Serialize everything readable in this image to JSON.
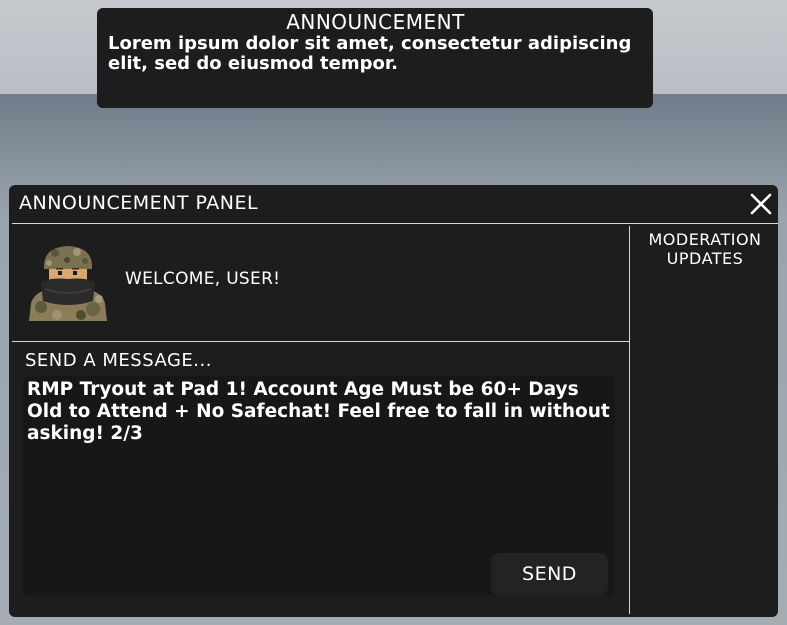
{
  "announcement": {
    "title": "ANNOUNCEMENT",
    "body": "Lorem ipsum dolor sit amet, consectetur adipiscing elit, sed do eiusmod tempor."
  },
  "panel": {
    "title": "ANNOUNCEMENT PANEL",
    "close_icon": "close-icon",
    "moderation_title": "MODERATION UPDATES",
    "welcome": "WELCOME, USER!",
    "send_label": "SEND A MESSAGE...",
    "message": "RMP Tryout at Pad 1! Account Age Must be 60+ Days Old to Attend + No Safechat! Feel free to fall in without asking! 2/3",
    "send_button": "SEND"
  },
  "colors": {
    "panel_bg": "#1d1d1d",
    "input_bg": "#171717",
    "button_bg": "#232323",
    "text": "#ffffff",
    "divider": "#d9d9d9"
  }
}
